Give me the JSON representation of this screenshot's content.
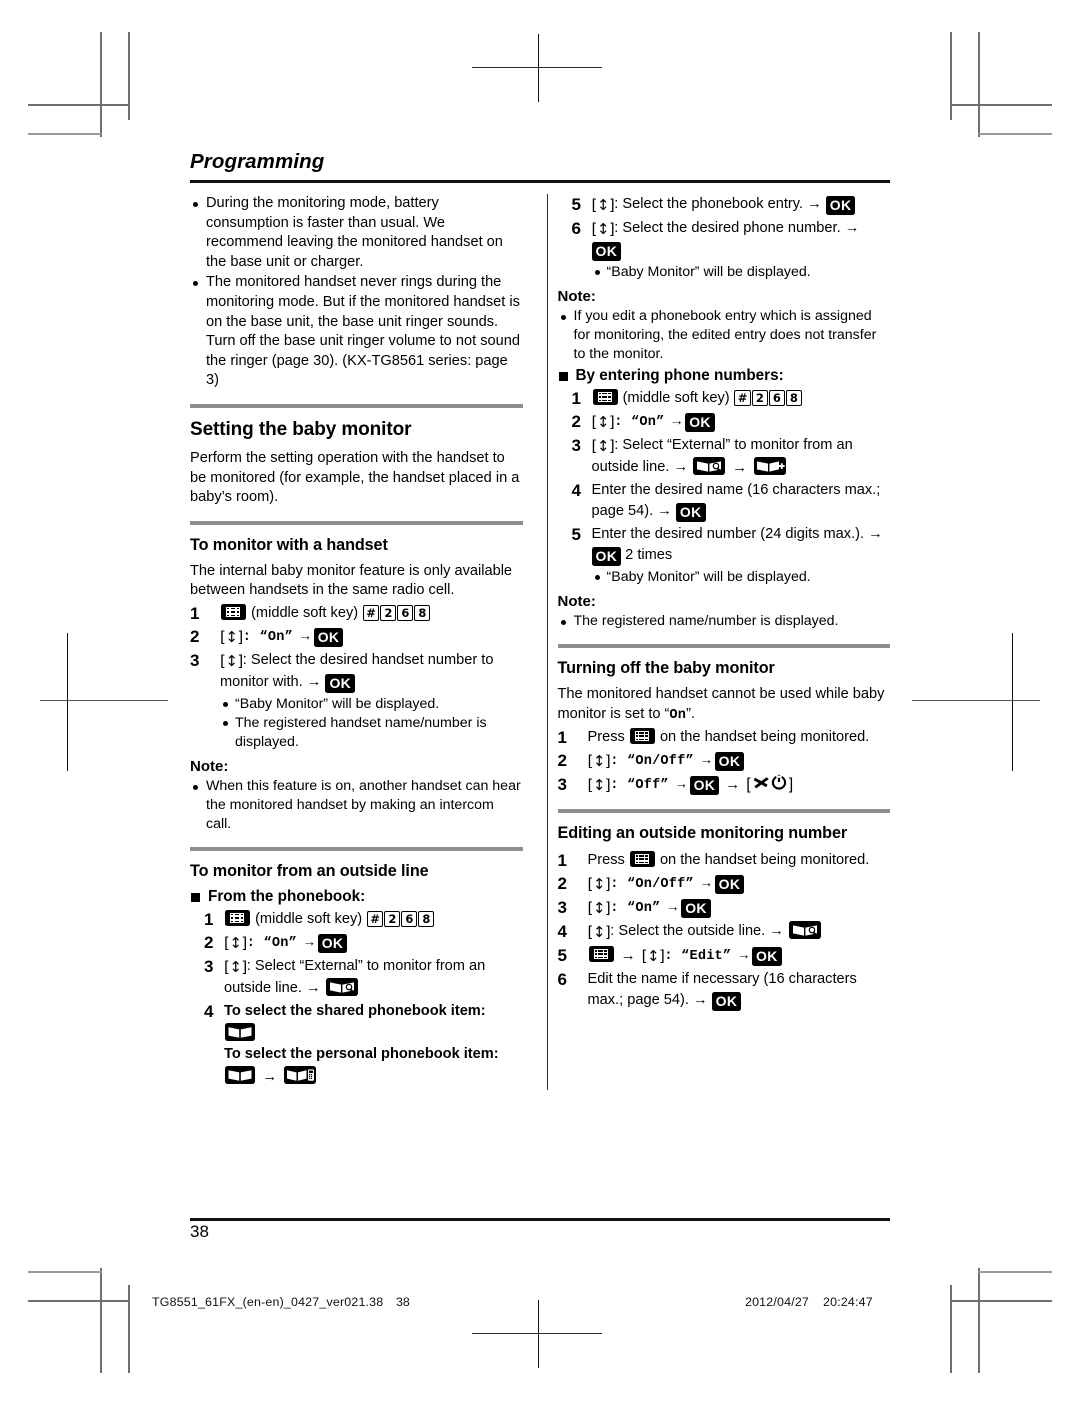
{
  "chapter": {
    "title": "Programming"
  },
  "left_column": {
    "intro_bullets": [
      "During the monitoring mode, battery consumption is faster than usual. We recommend leaving the monitored handset on the base unit or charger.",
      "The monitored handset never rings during the monitoring mode. But if the monitored handset is on the base unit, the base unit ringer sounds. Turn off the base unit ringer volume to not sound the ringer (page 30). (KX-TG8561 series: page 3)"
    ],
    "section_setting": {
      "heading": "Setting the baby monitor",
      "intro": "Perform the setting operation with the handset to be monitored (for example, the handset placed in a baby’s room).",
      "subsection_handset": {
        "heading": "To monitor with a handset",
        "intro": "The internal baby monitor feature is only available between handsets in the same radio cell.",
        "steps": [
          {
            "num": "1",
            "icon": "soft-key-icon",
            "text": "(middle soft key)",
            "keys": [
              "#",
              "2",
              "6",
              "8"
            ]
          },
          {
            "num": "2",
            "nav": "[↕]",
            "label": ": “On” →",
            "ok": "OK"
          },
          {
            "num": "3",
            "nav": "[↕]",
            "label": ": Select the desired handset number to monitor with. →",
            "ok": "OK",
            "bullets": [
              "“Baby Monitor” will be displayed.",
              "The registered handset name/number is displayed."
            ]
          }
        ],
        "note_label": "Note:",
        "notes": [
          "When this feature is on, another handset can hear the monitored handset by making an intercom call."
        ]
      },
      "subsection_outside": {
        "heading": "To monitor from an outside line",
        "group_label": "From the phonebook:",
        "steps": [
          {
            "num": "1",
            "icon": "soft-key-icon",
            "text": "(middle soft key)",
            "keys": [
              "#",
              "2",
              "6",
              "8"
            ]
          },
          {
            "num": "2",
            "nav": "[↕]",
            "label": ": “On” →",
            "ok": "OK"
          },
          {
            "num": "3",
            "nav": "[↕]",
            "label_a": ": Select “External” to monitor from an outside line. →",
            "icon": "phonebook-outside-icon"
          },
          {
            "num": "4",
            "line1": "To select the shared phonebook item:",
            "icon1": "phonebook-shared-icon",
            "line2": "To select the personal phonebook item:",
            "icon2a": "phonebook-shared-icon",
            "icon2b": "phonebook-personal-icon"
          }
        ]
      }
    }
  },
  "right_column": {
    "steps_continued": [
      {
        "num": "5",
        "nav": "[↕]",
        "label": ": Select the phonebook entry. →",
        "ok": "OK"
      },
      {
        "num": "6",
        "nav": "[↕]",
        "label": ": Select the desired phone number. →",
        "ok": "OK",
        "bullets": [
          "“Baby Monitor” will be displayed."
        ]
      }
    ],
    "note_label_1": "Note:",
    "notes_1": [
      "If you edit a phonebook entry which is assigned for monitoring, the edited entry does not transfer to the monitor."
    ],
    "group_label_numbers": "By entering phone numbers:",
    "steps_numbers": [
      {
        "num": "1",
        "icon": "soft-key-icon",
        "text": "(middle soft key)",
        "keys": [
          "#",
          "2",
          "6",
          "8"
        ]
      },
      {
        "num": "2",
        "nav": "[↕]",
        "label": ": “On” →",
        "ok": "OK"
      },
      {
        "num": "3",
        "nav": "[↕]",
        "label": ": Select “External” to monitor from an outside line. →",
        "icon_a": "phonebook-outside-icon",
        "icon_b": "phonebook-add-icon"
      },
      {
        "num": "4",
        "text": "Enter the desired name (16 characters max.; page 54). →",
        "ok": "OK"
      },
      {
        "num": "5",
        "text": "Enter the desired number (24 digits max.). →",
        "ok": "OK",
        "after": "2 times",
        "bullets": [
          "“Baby Monitor” will be displayed."
        ]
      }
    ],
    "note_label_2": "Note:",
    "notes_2": [
      "The registered name/number is displayed."
    ],
    "section_turning_off": {
      "heading": "Turning off the baby monitor",
      "intro_a": "The monitored handset cannot be used while baby monitor is set to “",
      "intro_on": "On",
      "intro_b": "”.",
      "steps": [
        {
          "num": "1",
          "pre": "Press",
          "icon": "soft-key-icon",
          "post": "on the handset being monitored."
        },
        {
          "num": "2",
          "nav": "[↕]",
          "label": ": “On/Off” →",
          "ok": "OK"
        },
        {
          "num": "3",
          "nav": "[↕]",
          "label": ": “Off” →",
          "ok": "OK",
          "arrow_to_power": "→",
          "power": "power-off-key-icon"
        }
      ]
    },
    "section_editing": {
      "heading": "Editing an outside monitoring number",
      "steps": [
        {
          "num": "1",
          "pre": "Press",
          "icon": "soft-key-icon",
          "post": "on the handset being monitored."
        },
        {
          "num": "2",
          "nav": "[↕]",
          "label": ": “On/Off” →",
          "ok": "OK"
        },
        {
          "num": "3",
          "nav": "[↕]",
          "label": ": “On” →",
          "ok": "OK"
        },
        {
          "num": "4",
          "nav": "[↕]",
          "label": ": Select the outside line. →",
          "icon": "phonebook-outside-icon"
        },
        {
          "num": "5",
          "icon": "soft-key-icon",
          "arrow": "→",
          "nav": "[↕]",
          "label": ": “Edit” →",
          "ok": "OK"
        },
        {
          "num": "6",
          "text": "Edit the name if necessary (16 characters max.; page 54). →",
          "ok": "OK"
        }
      ]
    }
  },
  "page_number": "38",
  "footer": {
    "left": "TG8551_61FX_(en-en)_0427_ver021.38",
    "page": "38",
    "date": "2012/04/27",
    "time": "20:24:47"
  },
  "colors": {
    "rule_gray": "#8d8d8d",
    "rule_black": "#111111",
    "crop_mark": "#6f6f6f"
  }
}
